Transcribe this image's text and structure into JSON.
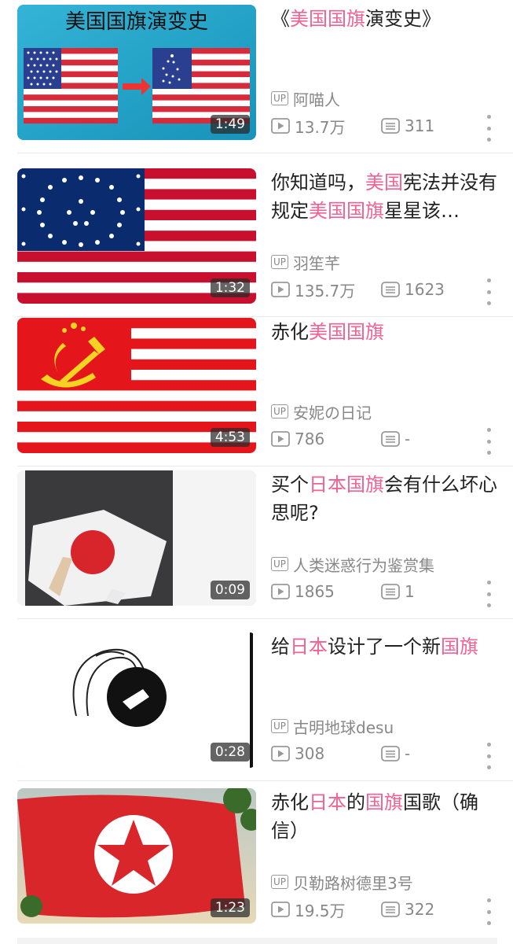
{
  "colors": {
    "highlight": "#f06292",
    "meta_text": "#888888",
    "title_text": "#222222"
  },
  "icons": {
    "uploader": "up-badge",
    "views": "play-icon",
    "comments": "comment-list-icon",
    "more": "more-vertical-icon"
  },
  "videos": [
    {
      "title_parts": [
        {
          "text": "《",
          "hl": false
        },
        {
          "text": "美国国旗",
          "hl": true
        },
        {
          "text": "演变史》",
          "hl": false
        }
      ],
      "duration": "1:49",
      "uploader": "阿喵人",
      "views": "13.7万",
      "comments": "311",
      "thumb_text": "美国国旗演变史"
    },
    {
      "title_parts": [
        {
          "text": "你知道吗，",
          "hl": false
        },
        {
          "text": "美国",
          "hl": true
        },
        {
          "text": "宪法并没有规定",
          "hl": false
        },
        {
          "text": "美国国旗",
          "hl": true
        },
        {
          "text": "星星该…",
          "hl": false
        }
      ],
      "duration": "1:32",
      "uploader": "羽笙芊",
      "views": "135.7万",
      "comments": "1623"
    },
    {
      "title_parts": [
        {
          "text": "赤化",
          "hl": false
        },
        {
          "text": "美国国旗",
          "hl": true
        }
      ],
      "duration": "4:53",
      "uploader": "安妮の日记",
      "views": "786",
      "comments": "-"
    },
    {
      "title_parts": [
        {
          "text": "买个",
          "hl": false
        },
        {
          "text": "日本国旗",
          "hl": true
        },
        {
          "text": "会有什么坏心思呢?",
          "hl": false
        }
      ],
      "duration": "0:09",
      "uploader": "人类迷惑行为鉴赏集",
      "views": "1865",
      "comments": "1"
    },
    {
      "title_parts": [
        {
          "text": "给",
          "hl": false
        },
        {
          "text": "日本",
          "hl": true
        },
        {
          "text": "设计了一个新",
          "hl": false
        },
        {
          "text": "国旗",
          "hl": true
        }
      ],
      "duration": "0:28",
      "uploader": "古明地球desu",
      "views": "308",
      "comments": "-"
    },
    {
      "title_parts": [
        {
          "text": "赤化",
          "hl": false
        },
        {
          "text": "日本",
          "hl": true
        },
        {
          "text": "的",
          "hl": false
        },
        {
          "text": "国旗",
          "hl": true
        },
        {
          "text": "国歌（确信）",
          "hl": false
        }
      ],
      "duration": "1:23",
      "uploader": "贝勒路树德里3号",
      "views": "19.5万",
      "comments": "322"
    }
  ]
}
